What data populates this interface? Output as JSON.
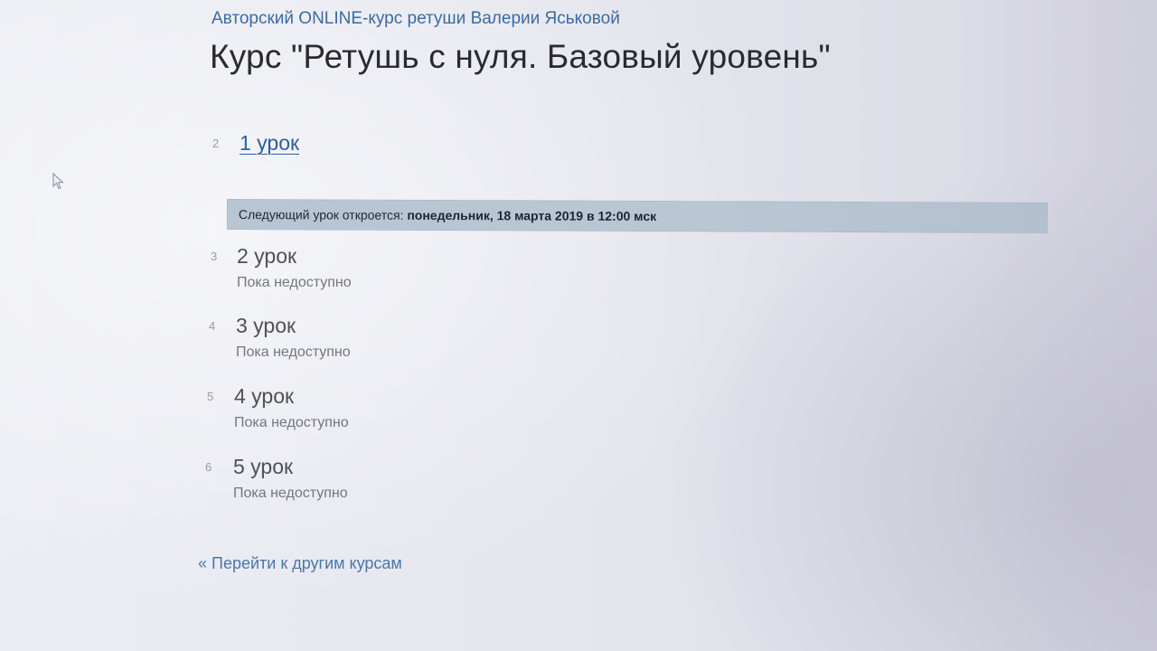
{
  "header": {
    "course_author_link": "Авторский ONLINE-курс ретуши Валерии Яськовой",
    "page_title": "Курс \"Ретушь с нуля. Базовый уровень\""
  },
  "lessons": [
    {
      "number": "2",
      "title": "1 урок",
      "status": ""
    },
    {
      "number": "3",
      "title": "2 урок",
      "status": "Пока недоступно"
    },
    {
      "number": "4",
      "title": "3 урок",
      "status": "Пока недоступно"
    },
    {
      "number": "5",
      "title": "4 урок",
      "status": "Пока недоступно"
    },
    {
      "number": "6",
      "title": "5 урок",
      "status": "Пока недоступно"
    }
  ],
  "next_lesson": {
    "label": "Следующий урок откроется:",
    "datetime": "понедельник, 18 марта 2019 в 12:00 мск"
  },
  "footer": {
    "back_link": "« Перейти к другим курсам"
  },
  "colors": {
    "link": "#3a6aa5",
    "banner": "#b8c6d4",
    "title": "#2b2b2f"
  },
  "icons": {
    "cursor": "mouse-pointer-icon"
  }
}
